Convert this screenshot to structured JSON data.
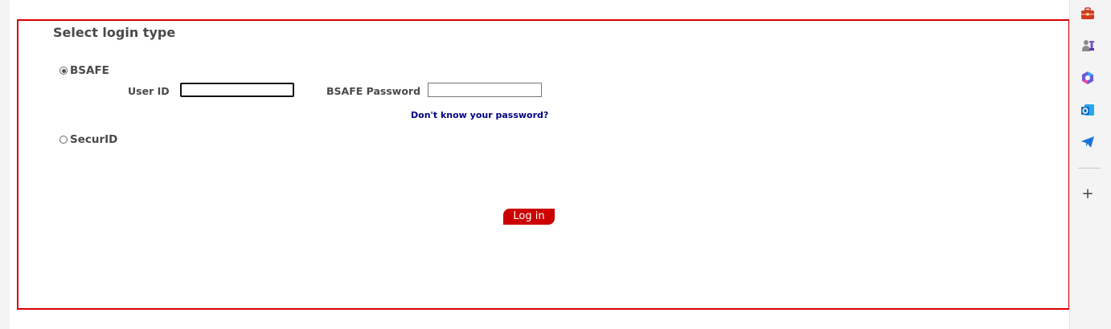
{
  "form": {
    "title": "Select login type",
    "options": [
      {
        "label": "BSAFE",
        "selected": true
      },
      {
        "label": "SecurID",
        "selected": false
      }
    ],
    "user_id_label": "User ID",
    "user_id_value": "",
    "password_label": "BSAFE Password",
    "password_value": "",
    "forgot_link": "Don't know your password?",
    "login_button": "Log in"
  },
  "sidebar": {
    "icons": [
      "toolbox-icon",
      "chess-icon",
      "copilot-icon",
      "outlook-icon",
      "telegram-icon",
      "add-icon"
    ],
    "add_label": "+"
  },
  "colors": {
    "accent_red": "#cc0000",
    "frame_red": "#d90000",
    "link_navy": "#000080"
  }
}
